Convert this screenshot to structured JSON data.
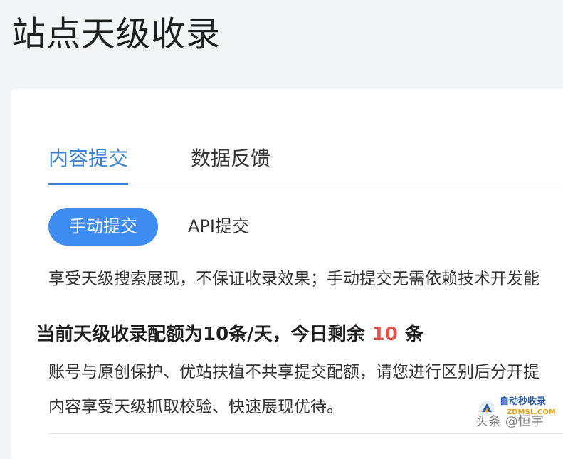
{
  "page": {
    "title": "站点天级收录"
  },
  "tabs": [
    {
      "label": "内容提交",
      "active": true
    },
    {
      "label": "数据反馈",
      "active": false
    }
  ],
  "subtabs": [
    {
      "label": "手动提交",
      "active": true
    },
    {
      "label": "API提交",
      "active": false
    }
  ],
  "description": "享受天级搜索展现，不保证收录效果；手动提交无需依赖技术开发能",
  "quota": {
    "prefix": "当前天级收录配额为10条/天，今日剩余",
    "remaining": "10",
    "suffix": "条"
  },
  "notes": [
    "账号与原创保护、优站扶植不共享提交配额，请您进行区别后分开提",
    "内容享受天级抓取校验、快速展现优待。"
  ],
  "watermark": {
    "brand": "自动秒收录",
    "domain": "ZDMSL.COM",
    "author": "头条 @恒宇"
  },
  "colors": {
    "accent": "#3b84d8",
    "button": "#3f8cf0",
    "highlight": "#e0524a",
    "background": "#f3f4f6"
  }
}
